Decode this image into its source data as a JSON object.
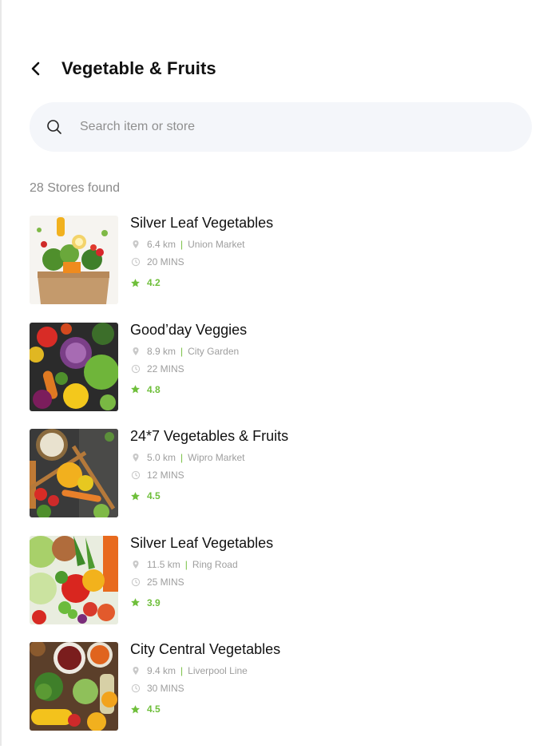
{
  "header": {
    "title": "Vegetable & Fruits"
  },
  "search": {
    "placeholder": "Search item or store"
  },
  "results_count": "28 Stores found",
  "colors": {
    "accent": "#6fbf3b",
    "search_bg": "#f4f6fa"
  },
  "icons": {
    "back": "back-arrow-icon",
    "search": "search-icon",
    "location": "location-pin-icon",
    "time": "clock-icon",
    "rating": "star-icon"
  },
  "stores": [
    {
      "name": "Silver Leaf Vegetables",
      "distance": "6.4 km",
      "area": "Union Market",
      "time": "20 MINS",
      "rating": "4.2"
    },
    {
      "name": "Good’day Veggies",
      "distance": "8.9 km",
      "area": "City Garden",
      "time": "22 MINS",
      "rating": "4.8"
    },
    {
      "name": "24*7 Vegetables & Fruits",
      "distance": "5.0 km",
      "area": "Wipro Market",
      "time": "12 MINS",
      "rating": "4.5"
    },
    {
      "name": "Silver Leaf Vegetables",
      "distance": "11.5 km",
      "area": "Ring Road",
      "time": "25 MINS",
      "rating": "3.9"
    },
    {
      "name": "City Central Vegetables",
      "distance": "9.4 km",
      "area": "Liverpool Line",
      "time": "30 MINS",
      "rating": "4.5"
    }
  ]
}
